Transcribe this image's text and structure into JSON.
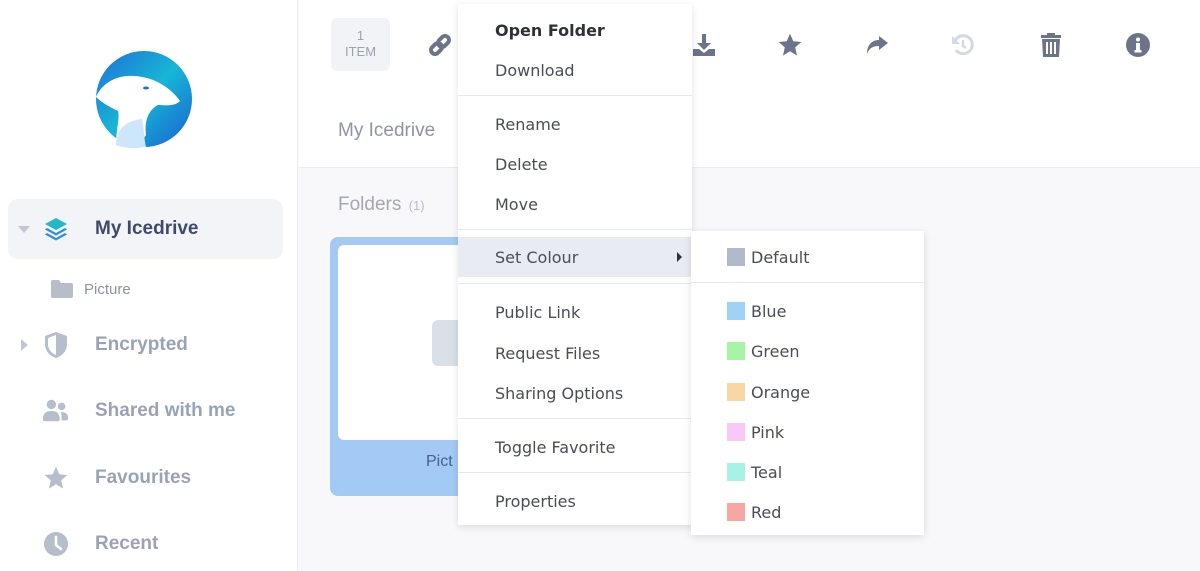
{
  "sidebar": {
    "logo": "icedrive-polar-bear-logo",
    "items": [
      {
        "label": "My Icedrive",
        "icon": "layers-icon",
        "active": true,
        "expanded": true
      },
      {
        "label": "Encrypted",
        "icon": "shield-icon",
        "expandable": true
      },
      {
        "label": "Shared with me",
        "icon": "users-icon"
      },
      {
        "label": "Favourites",
        "icon": "star-icon"
      },
      {
        "label": "Recent",
        "icon": "clock-icon"
      }
    ],
    "subitems": [
      {
        "label": "Picture",
        "icon": "folder-icon"
      }
    ]
  },
  "header": {
    "selection_count": "1",
    "selection_unit": "ITEM",
    "toolbar": [
      "link-icon",
      "download-icon",
      "star-icon",
      "share-icon",
      "restore-icon",
      "trash-icon",
      "info-icon"
    ],
    "breadcrumb": "My Icedrive"
  },
  "main": {
    "folders_title": "Folders",
    "folders_count": "(1)",
    "folders": [
      {
        "name": "Pict",
        "selected": true
      }
    ]
  },
  "context_menu": {
    "items": [
      {
        "label": "Open Folder",
        "bold": true
      },
      {
        "label": "Download"
      },
      {
        "label": "Rename"
      },
      {
        "label": "Delete"
      },
      {
        "label": "Move"
      },
      {
        "label": "Set Colour",
        "submenu": true,
        "highlighted": true
      },
      {
        "label": "Public Link"
      },
      {
        "label": "Request Files"
      },
      {
        "label": "Sharing Options"
      },
      {
        "label": "Toggle Favorite"
      },
      {
        "label": "Properties"
      }
    ]
  },
  "colour_submenu": {
    "items": [
      {
        "label": "Default",
        "color": "#b1b9cc"
      },
      {
        "label": "Blue",
        "color": "#9fd3f5"
      },
      {
        "label": "Green",
        "color": "#a6f5a6"
      },
      {
        "label": "Orange",
        "color": "#f8d6a6"
      },
      {
        "label": "Pink",
        "color": "#f8c9f8"
      },
      {
        "label": "Teal",
        "color": "#a6f2e6"
      },
      {
        "label": "Red",
        "color": "#f7a6a0"
      }
    ]
  }
}
